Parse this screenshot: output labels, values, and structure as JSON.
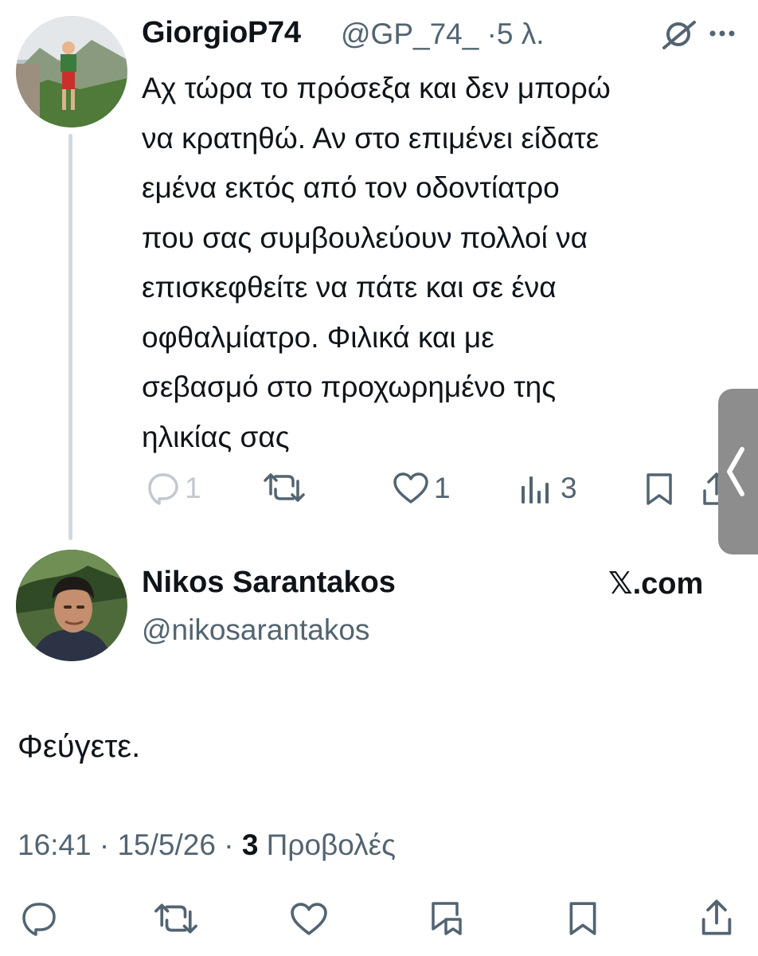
{
  "parent_tweet": {
    "display_name": "GiorgioP74",
    "handle_time": "@GP_74_ ·5 λ.",
    "body_lines": [
      "Αχ τώρα το πρόσεξα και δεν μπορώ",
      "να κρατηθώ. Αν στο επιμένει είδατε",
      "εμένα εκτός από τον οδοντίατρο",
      "που σας συμβουλεύουν πολλοί να",
      "επισκεφθείτε να πάτε και σε ένα",
      "οφθαλμίατρο. Φιλικά και με",
      "σεβασμό στο προχωρημένο της",
      "ηλικίας σας"
    ],
    "actions": {
      "reply_count": "1",
      "like_count": "1",
      "views_count": "3"
    },
    "icons": [
      "grok-icon",
      "more-icon",
      "reply-icon",
      "retweet-icon",
      "like-icon",
      "views-icon",
      "bookmark-icon",
      "share-icon"
    ]
  },
  "main_tweet": {
    "display_name": "Nikos Sarantakos",
    "handle": "@nikosarantakos",
    "brand": "𝕏.com",
    "text": "Φεύγετε.",
    "time_date": "16:41 · 15/5/26 · ",
    "views_count": "3",
    "views_label": " Προβολές",
    "actions": [
      "reply-icon",
      "retweet-icon",
      "like-icon",
      "bookmark-stack-icon",
      "bookmark-icon",
      "share-icon"
    ]
  },
  "colors": {
    "text": "#0f1419",
    "secondary": "#536471",
    "icon": "#536471",
    "thread_line": "#cfd9de",
    "edge_tab": "#8d8d8d"
  }
}
